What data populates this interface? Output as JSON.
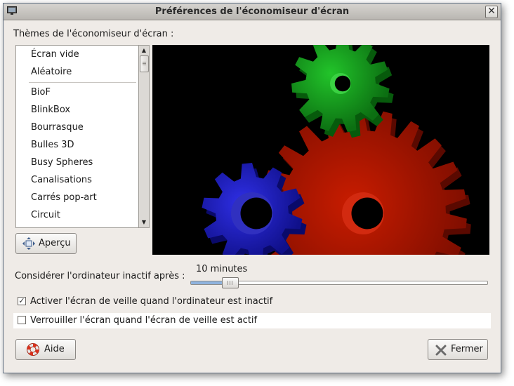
{
  "window": {
    "title": "Préférences de l'économiseur d'écran",
    "close_glyph": "✕"
  },
  "themes": {
    "label": "Thèmes de l'économiseur d'écran :",
    "special_items": [
      "Écran vide",
      "Aléatoire"
    ],
    "items": [
      "BioF",
      "BlinkBox",
      "Bourrasque",
      "Bulles 3D",
      "Busy Spheres",
      "Canalisations",
      "Carrés pop-art",
      "Circuit"
    ],
    "scroll_up_glyph": "▲",
    "scroll_down_glyph": "▼"
  },
  "preview": {
    "colors": {
      "background": "#000000",
      "red_gear": "#b01500",
      "green_gear": "#15a01a",
      "blue_gear": "#1f1fd0"
    }
  },
  "buttons": {
    "preview_label": "Aperçu",
    "help_label": "Aide",
    "close_label": "Fermer",
    "preview_icon": "fullscreen-arrows-icon",
    "help_icon": "lifebuoy-icon",
    "close_icon": "x-close-icon"
  },
  "idle": {
    "label": "Considérer l'ordinateur inactif après :",
    "value_text": "10 minutes",
    "slider_fraction": 0.1
  },
  "options": {
    "activate_label": "Activer l'écran de veille quand l'ordinateur est inactif",
    "activate_checked": true,
    "lock_label": "Verrouiller l'écran quand l'écran de veille est actif",
    "lock_checked": false,
    "check_glyph": "✓"
  }
}
